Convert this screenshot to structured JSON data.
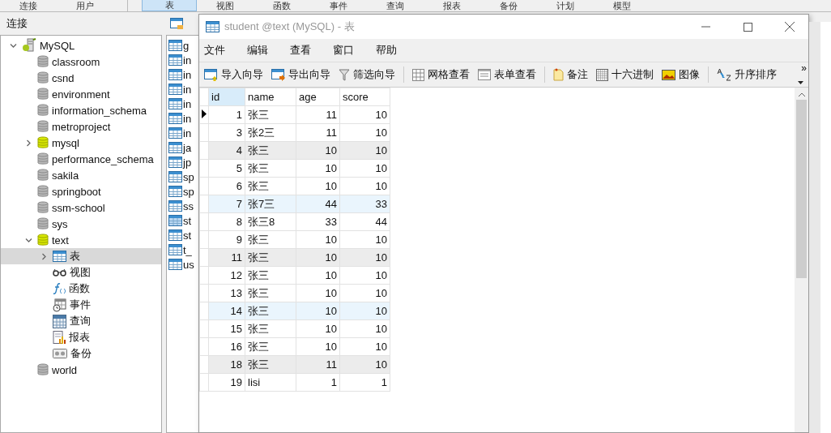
{
  "top_toolbar": {
    "groups": [
      [
        {
          "label": "连接",
          "selected": false
        },
        {
          "label": "用户",
          "selected": false
        }
      ],
      [
        {
          "label": "表",
          "selected": true
        },
        {
          "label": "视图",
          "selected": false
        },
        {
          "label": "函数",
          "selected": false
        },
        {
          "label": "事件",
          "selected": false
        },
        {
          "label": "查询",
          "selected": false
        },
        {
          "label": "报表",
          "selected": false
        },
        {
          "label": "备份",
          "selected": false
        },
        {
          "label": "计划",
          "selected": false
        },
        {
          "label": "模型",
          "selected": false
        }
      ]
    ]
  },
  "connections_panel": {
    "title": "连接",
    "tree": [
      {
        "label": "MySQL",
        "kind": "server",
        "expanded": true,
        "selected": false,
        "children": [
          {
            "label": "classroom",
            "kind": "database",
            "connected": false,
            "selected": false
          },
          {
            "label": "csnd",
            "kind": "database",
            "connected": false,
            "selected": false
          },
          {
            "label": "environment",
            "kind": "database",
            "connected": false,
            "selected": false
          },
          {
            "label": "information_schema",
            "kind": "database",
            "connected": false,
            "selected": false
          },
          {
            "label": "metroproject",
            "kind": "database",
            "connected": false,
            "selected": false
          },
          {
            "label": "mysql",
            "kind": "database",
            "connected": true,
            "expanded": false,
            "selected": false
          },
          {
            "label": "performance_schema",
            "kind": "database",
            "connected": false,
            "selected": false
          },
          {
            "label": "sakila",
            "kind": "database",
            "connected": false,
            "selected": false
          },
          {
            "label": "springboot",
            "kind": "database",
            "connected": false,
            "selected": false
          },
          {
            "label": "ssm-school",
            "kind": "database",
            "connected": false,
            "selected": false
          },
          {
            "label": "sys",
            "kind": "database",
            "connected": false,
            "selected": false
          },
          {
            "label": "text",
            "kind": "database",
            "connected": true,
            "expanded": true,
            "selected": false,
            "children": [
              {
                "label": "表",
                "kind": "tables",
                "expanded": false,
                "selected": true
              },
              {
                "label": "视图",
                "kind": "views",
                "selected": false
              },
              {
                "label": "函数",
                "kind": "functions",
                "selected": false
              },
              {
                "label": "事件",
                "kind": "events",
                "selected": false
              },
              {
                "label": "查询",
                "kind": "queries",
                "selected": false
              },
              {
                "label": "报表",
                "kind": "reports",
                "selected": false
              },
              {
                "label": "备份",
                "kind": "backups",
                "selected": false
              }
            ]
          },
          {
            "label": "world",
            "kind": "database",
            "connected": false,
            "selected": false
          }
        ]
      }
    ]
  },
  "object_list": {
    "items": [
      {
        "label": "g",
        "selected": false
      },
      {
        "label": "in",
        "selected": false
      },
      {
        "label": "in",
        "selected": false
      },
      {
        "label": "in",
        "selected": false
      },
      {
        "label": "in",
        "selected": false
      },
      {
        "label": "in",
        "selected": false
      },
      {
        "label": "in",
        "selected": false
      },
      {
        "label": "ja",
        "selected": false
      },
      {
        "label": "jp",
        "selected": false
      },
      {
        "label": "sp",
        "selected": false
      },
      {
        "label": "sp",
        "selected": false
      },
      {
        "label": "ss",
        "selected": false
      },
      {
        "label": "st",
        "selected": true
      },
      {
        "label": "st",
        "selected": false
      },
      {
        "label": "t_",
        "selected": false
      },
      {
        "label": "us",
        "selected": false
      }
    ]
  },
  "window": {
    "title": "student @text (MySQL) - 表",
    "menu": [
      "文件",
      "编辑",
      "查看",
      "窗口",
      "帮助"
    ],
    "toolbar": [
      [
        {
          "label": "导入向导",
          "kind": "import"
        },
        {
          "label": "导出向导",
          "kind": "export"
        },
        {
          "label": "筛选向导",
          "kind": "filter"
        }
      ],
      [
        {
          "label": "网格查看",
          "kind": "grid"
        },
        {
          "label": "表单查看",
          "kind": "form"
        }
      ],
      [
        {
          "label": "备注",
          "kind": "memo"
        },
        {
          "label": "十六进制",
          "kind": "hex"
        },
        {
          "label": "图像",
          "kind": "image"
        }
      ],
      [
        {
          "label": "升序排序",
          "kind": "sort"
        }
      ]
    ],
    "more_button": "»",
    "table": {
      "columns": [
        "id",
        "name",
        "age",
        "score"
      ],
      "rows": [
        {
          "cells": [
            "1",
            "张三",
            "11",
            "10"
          ],
          "kind": "plain",
          "selected": true
        },
        {
          "cells": [
            "3",
            "张2三",
            "11",
            "10"
          ],
          "kind": "plain",
          "selected": false
        },
        {
          "cells": [
            "4",
            "张三",
            "10",
            "10"
          ],
          "kind": "grey",
          "selected": false
        },
        {
          "cells": [
            "5",
            "张三",
            "10",
            "10"
          ],
          "kind": "plain",
          "selected": false
        },
        {
          "cells": [
            "6",
            "张三",
            "10",
            "10"
          ],
          "kind": "plain",
          "selected": false
        },
        {
          "cells": [
            "7",
            "张7三",
            "44",
            "33"
          ],
          "kind": "blue",
          "selected": false
        },
        {
          "cells": [
            "8",
            "张三8",
            "33",
            "44"
          ],
          "kind": "plain",
          "selected": false
        },
        {
          "cells": [
            "9",
            "张三",
            "10",
            "10"
          ],
          "kind": "plain",
          "selected": false
        },
        {
          "cells": [
            "11",
            "张三",
            "10",
            "10"
          ],
          "kind": "grey",
          "selected": false
        },
        {
          "cells": [
            "12",
            "张三",
            "10",
            "10"
          ],
          "kind": "plain",
          "selected": false
        },
        {
          "cells": [
            "13",
            "张三",
            "10",
            "10"
          ],
          "kind": "plain",
          "selected": false
        },
        {
          "cells": [
            "14",
            "张三",
            "10",
            "10"
          ],
          "kind": "blue",
          "selected": false
        },
        {
          "cells": [
            "15",
            "张三",
            "10",
            "10"
          ],
          "kind": "plain",
          "selected": false
        },
        {
          "cells": [
            "16",
            "张三",
            "10",
            "10"
          ],
          "kind": "plain",
          "selected": false
        },
        {
          "cells": [
            "18",
            "张三",
            "11",
            "10"
          ],
          "kind": "grey",
          "selected": false
        },
        {
          "cells": [
            "19",
            "lisi",
            "1",
            "1"
          ],
          "kind": "plain",
          "selected": false
        }
      ]
    }
  }
}
